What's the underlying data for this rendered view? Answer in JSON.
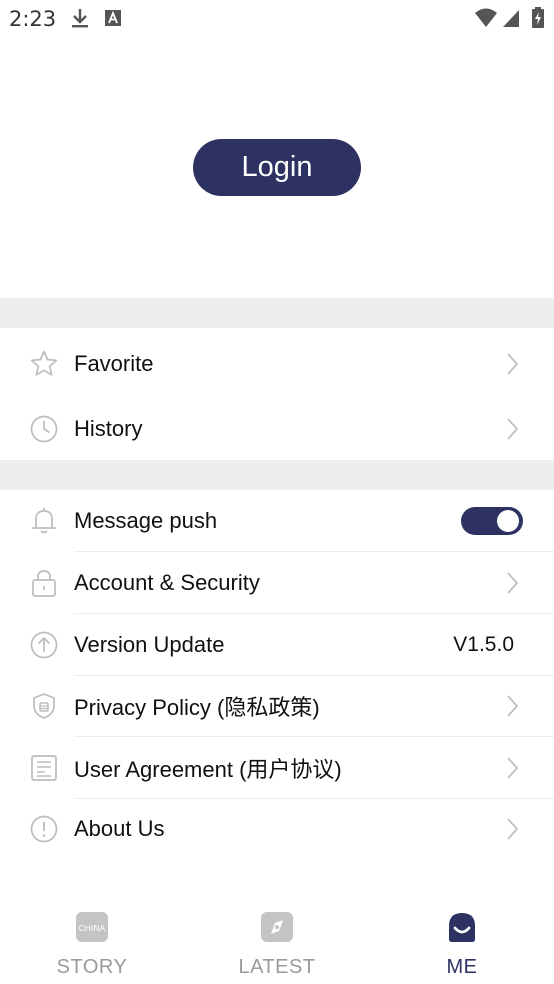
{
  "status_bar": {
    "time": "2:23"
  },
  "login": {
    "label": "Login"
  },
  "menu_group_1": [
    {
      "label": "Favorite",
      "icon": "star-icon"
    },
    {
      "label": "History",
      "icon": "clock-icon"
    }
  ],
  "menu_group_2": {
    "message_push": {
      "label": "Message push",
      "icon": "bell-icon",
      "enabled": true
    },
    "account_security": {
      "label": "Account & Security",
      "icon": "lock-icon"
    },
    "version_update": {
      "label": "Version Update",
      "icon": "arrow-up-circle-icon",
      "value": "V1.5.0"
    },
    "privacy_policy": {
      "label": "Privacy Policy (隐私政策)",
      "icon": "shield-icon"
    },
    "user_agreement": {
      "label": "User Agreement (用户协议)",
      "icon": "document-icon"
    },
    "about_us": {
      "label": "About Us",
      "icon": "info-circle-icon"
    }
  },
  "tabs": [
    {
      "label": "STORY",
      "icon": "china-badge-icon",
      "badge_text": "CHINA",
      "active": false
    },
    {
      "label": "LATEST",
      "icon": "compass-icon",
      "active": false
    },
    {
      "label": "ME",
      "icon": "user-face-icon",
      "active": true
    }
  ],
  "colors": {
    "accent": "#2d3263",
    "divider": "#eeeeee",
    "inactive": "#9a9a9a",
    "icon": "#c8c8c8"
  }
}
